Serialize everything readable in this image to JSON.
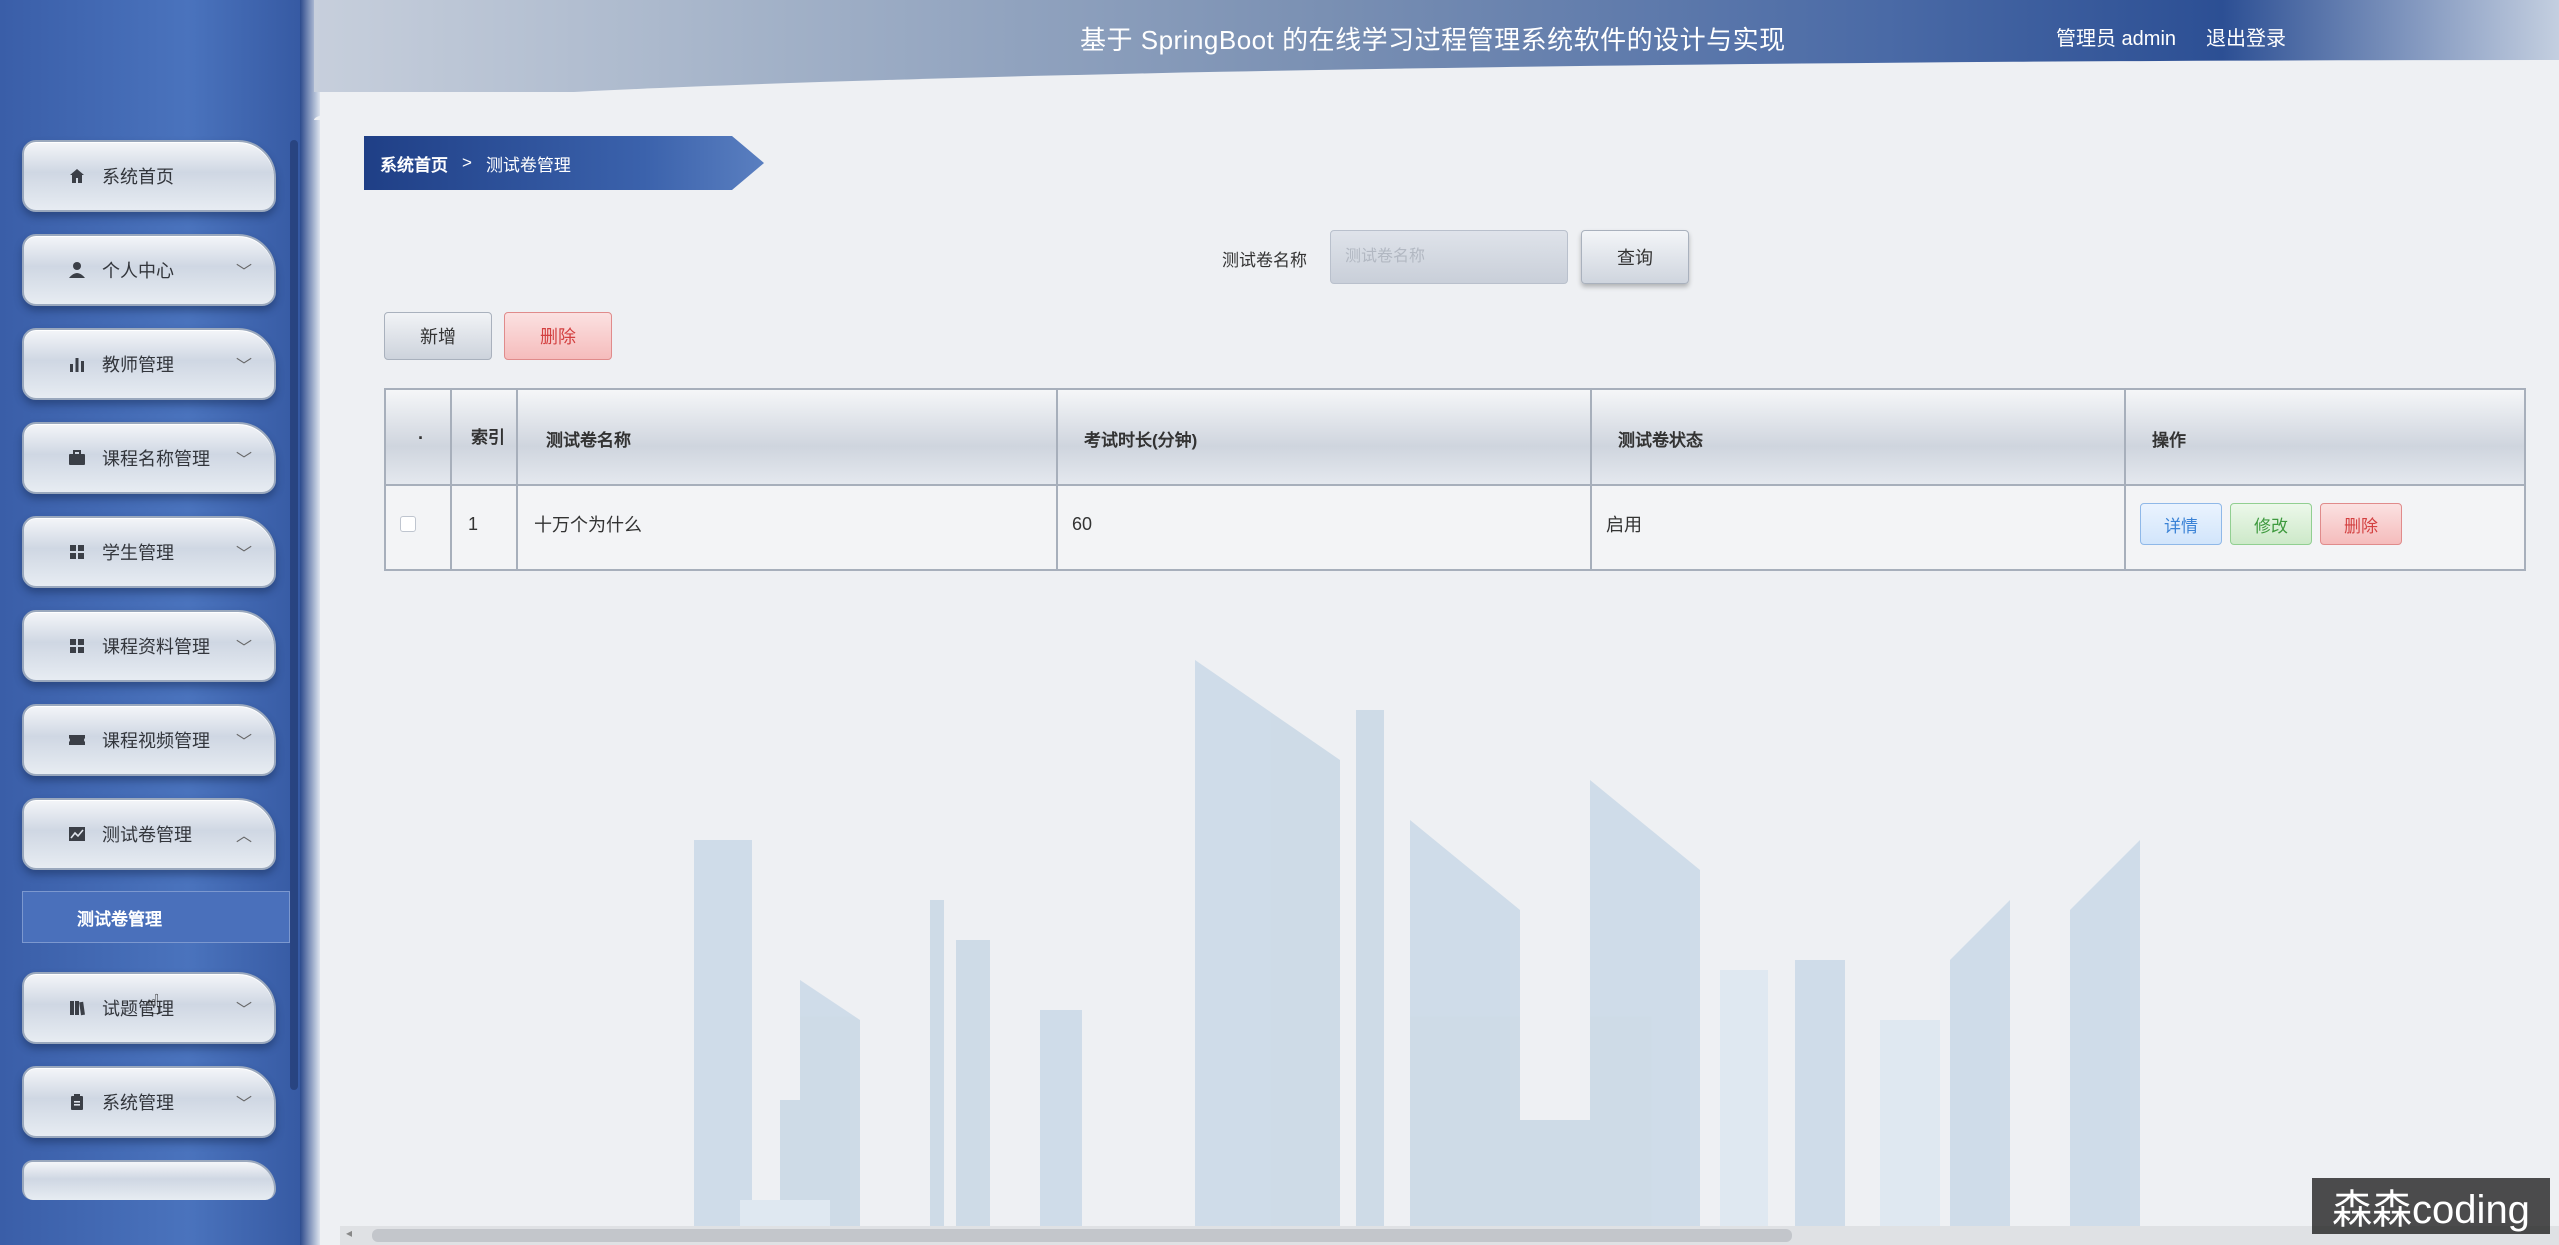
{
  "header": {
    "title": "基于 SpringBoot 的在线学习过程管理系统软件的设计与实现",
    "user": "管理员 admin",
    "logout": "退出登录"
  },
  "sidebar": {
    "items": [
      {
        "label": "系统首页",
        "icon": "home-icon",
        "has_chevron": false
      },
      {
        "label": "个人中心",
        "icon": "user-icon",
        "has_chevron": true
      },
      {
        "label": "教师管理",
        "icon": "bar-chart-icon",
        "has_chevron": true
      },
      {
        "label": "课程名称管理",
        "icon": "briefcase-icon",
        "has_chevron": true
      },
      {
        "label": "学生管理",
        "icon": "grid-icon",
        "has_chevron": true
      },
      {
        "label": "课程资料管理",
        "icon": "grid-icon",
        "has_chevron": true
      },
      {
        "label": "课程视频管理",
        "icon": "ticket-icon",
        "has_chevron": true
      },
      {
        "label": "测试卷管理",
        "icon": "trend-icon",
        "has_chevron": true,
        "expanded": true
      },
      {
        "label": "试题管理",
        "icon": "book-icon",
        "has_chevron": true
      },
      {
        "label": "系统管理",
        "icon": "clipboard-icon",
        "has_chevron": true
      }
    ],
    "submenu": {
      "label": "测试卷管理"
    }
  },
  "breadcrumb": {
    "home": "系统首页",
    "separator": ">",
    "current": "测试卷管理"
  },
  "search": {
    "label": "测试卷名称",
    "placeholder": "测试卷名称",
    "button": "查询"
  },
  "toolbar": {
    "add": "新增",
    "delete": "删除"
  },
  "table": {
    "headers": {
      "checkbox": "",
      "index": "索引",
      "name": "测试卷名称",
      "duration": "考试时长(分钟)",
      "status": "测试卷状态",
      "actions": "操作"
    },
    "rows": [
      {
        "index": "1",
        "name": "十万个为什么",
        "duration": "60",
        "status": "启用",
        "detail": "详情",
        "edit": "修改",
        "delete": "删除"
      }
    ]
  },
  "watermark": "森森coding"
}
